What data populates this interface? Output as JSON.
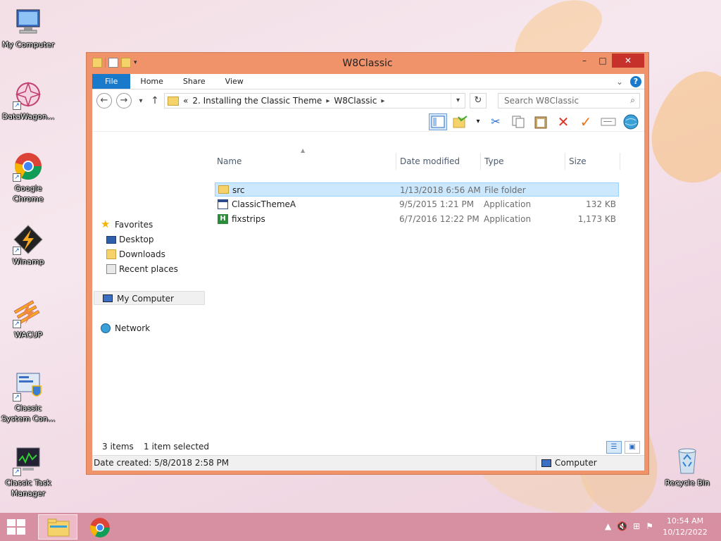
{
  "desktop": {
    "icons": [
      {
        "label": "My Computer",
        "icon": "computer-icon"
      },
      {
        "label": "DataWagon...",
        "icon": "datawagon-icon"
      },
      {
        "label": "Google Chrome",
        "icon": "chrome-icon"
      },
      {
        "label": "Winamp",
        "icon": "winamp-icon"
      },
      {
        "label": "WACUP",
        "icon": "wacup-icon"
      },
      {
        "label": "Classic System Con...",
        "icon": "control-panel-icon"
      },
      {
        "label": "Classic Task Manager",
        "icon": "task-manager-icon"
      },
      {
        "label": "Recycle Bin",
        "icon": "recycle-bin-icon"
      }
    ]
  },
  "window": {
    "title": "W8Classic",
    "controls": {
      "minimize": "–",
      "maximize": "□",
      "close": "✕"
    }
  },
  "ribbon": {
    "tabs": [
      "File",
      "Home",
      "Share",
      "View"
    ],
    "help": "?",
    "expand": "⌄"
  },
  "address": {
    "overflow": "«",
    "crumbs": [
      "2. Installing the Classic Theme",
      "W8Classic"
    ],
    "search_placeholder": "Search W8Classic"
  },
  "nav_pane": {
    "favorites": "Favorites",
    "favorites_items": [
      "Desktop",
      "Downloads",
      "Recent places"
    ],
    "my_computer": "My Computer",
    "network": "Network"
  },
  "file_list": {
    "columns": [
      "Name",
      "Date modified",
      "Type",
      "Size"
    ],
    "rows": [
      {
        "name": "src",
        "date": "1/13/2018 6:56 AM",
        "type": "File folder",
        "size": "",
        "icon": "folder-icon",
        "selected": true
      },
      {
        "name": "ClassicThemeA",
        "date": "9/5/2015 1:21 PM",
        "type": "Application",
        "size": "132 KB",
        "icon": "application-icon",
        "selected": false
      },
      {
        "name": "fixstrips",
        "date": "6/7/2016 12:22 PM",
        "type": "Application",
        "size": "1,173 KB",
        "icon": "fixstrips-app-icon",
        "selected": false
      }
    ]
  },
  "status": {
    "items": "3 items",
    "selected": "1 item selected",
    "date_created": "Date created: 5/8/2018 2:58 PM",
    "location": "Computer"
  },
  "taskbar": {
    "time": "10:54 AM",
    "date": "10/12/2022"
  },
  "colors": {
    "accent": "#1979ca",
    "window_frame": "#f0926a",
    "close_button": "#c7312b",
    "selection": "#cce8ff"
  }
}
